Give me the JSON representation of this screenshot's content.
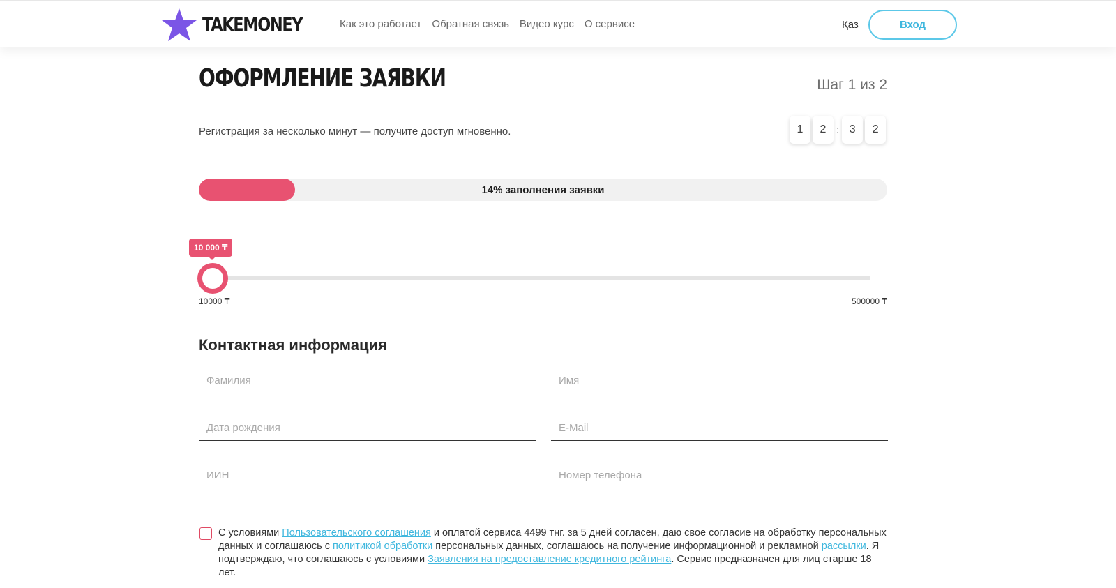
{
  "header": {
    "brand": "TAKEMONEY",
    "nav": [
      "Как это работает",
      "Обратная связь",
      "Видео курс",
      "О сервисе"
    ],
    "lang": "Қаз",
    "login_label": "Вход",
    "logo_color": "#7b55e6"
  },
  "form": {
    "title": "ОФОРМЛЕНИЕ ЗАЯВКИ",
    "step": "Шаг 1 из 2",
    "subtitle": "Регистрация за несколько минут — получите доступ мгновенно.",
    "timer": {
      "d1": "1",
      "d2": "2",
      "sep": ":",
      "d3": "3",
      "d4": "2"
    },
    "progress": {
      "percent": 14,
      "label": "14% заполнения заявки"
    },
    "slider": {
      "value": 10000,
      "badge": "10 000 ₸",
      "min": 10000,
      "max": 500000,
      "min_label": "10000 ₸",
      "max_label": "500000 ₸"
    },
    "contact_title": "Контактная информация",
    "fields": {
      "last_name": "Фамилия",
      "first_name": "Имя",
      "birth_date": "Дата рождения",
      "email": "E-Mail",
      "iin": "ИИН",
      "phone": "Номер телефона"
    },
    "consent": {
      "t1": "С условиями ",
      "link1": "Пользовательского соглашения",
      "t2": " и оплатой сервиса 4499 тнг. за 5 дней согласен, даю свое согласие на обработку персональных данных и соглашаюсь с ",
      "link2": "политикой обработки",
      "t3": " персональных данных, соглашаюсь на получение информационной и рекламной ",
      "link3": "рассылки",
      "t4": ". Я подтверждаю, что соглашаюсь с условиями ",
      "link4": "Заявления на предоставление кредитного рейтинга",
      "t5": ". Сервис предназначен для лиц старше 18 лет."
    }
  },
  "colors": {
    "accent": "#e85271",
    "link": "#3fb7de"
  }
}
